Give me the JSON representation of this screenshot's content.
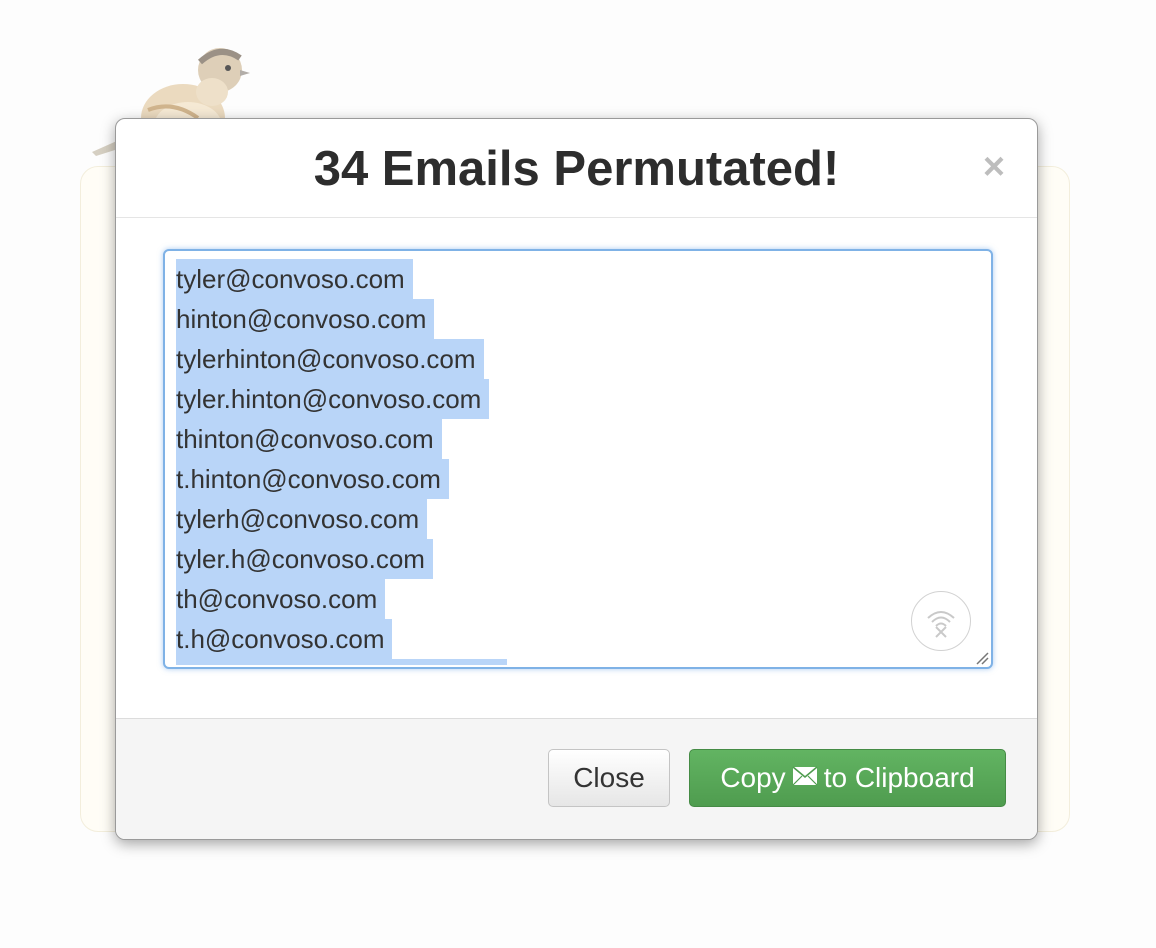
{
  "modal": {
    "title": "34 Emails Permutated!",
    "close_symbol": "×",
    "emails": [
      "tyler@convoso.com",
      "hinton@convoso.com",
      "tylerhinton@convoso.com",
      "tyler.hinton@convoso.com",
      "thinton@convoso.com",
      "t.hinton@convoso.com",
      "tylerh@convoso.com",
      "tyler.h@convoso.com",
      "th@convoso.com",
      "t.h@convoso.com"
    ],
    "footer": {
      "close_label": "Close",
      "copy_label_before": "Copy",
      "copy_label_after": "to Clipboard",
      "copy_icon": "envelope-icon"
    }
  },
  "colors": {
    "selection_highlight": "#b9d5f8",
    "copy_button": "#5aaa5a",
    "textarea_focus": "#7fb2e6"
  }
}
